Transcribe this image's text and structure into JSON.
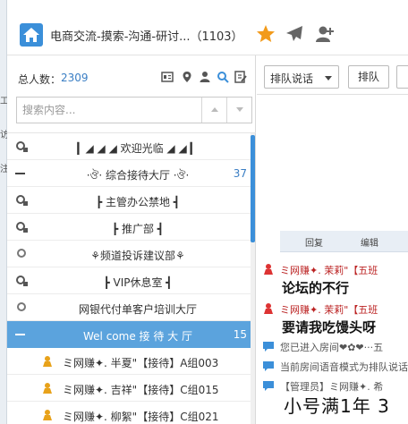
{
  "window": {
    "title": "电商交流-摸索-沟通-研讨...（1103）"
  },
  "background_window": {
    "fragments": [
      "工",
      "访",
      "注"
    ]
  },
  "stats": {
    "label": "总人数：",
    "count": "2309"
  },
  "search": {
    "placeholder": "搜索内容..."
  },
  "channels": [
    {
      "name": "▎◢ ◢ ◢  欢迎光临  ◢ ◢ ▎",
      "count": ""
    },
    {
      "name": "·ঔ· 综合接待大厅 ·ঔ·",
      "count": "37"
    },
    {
      "name": "┣    主管办公禁地    ┫",
      "count": ""
    },
    {
      "name": "┣   推广部   ┫",
      "count": ""
    },
    {
      "name": "⚘频道投诉建议部⚘",
      "count": ""
    },
    {
      "name": "┣   VIP休息室   ┫",
      "count": ""
    },
    {
      "name": "网银代付单客户培训大厅",
      "count": ""
    },
    {
      "name": "Wel come  接 待 大 厅",
      "count": "15"
    }
  ],
  "members": [
    {
      "name": "ミ网赚✦. 半夏\"【接待】A组003"
    },
    {
      "name": "ミ网赚✦. 吉祥\"【接待】C组015"
    },
    {
      "name": "ミ网赚✦. 柳絮\"【接待】C组021"
    }
  ],
  "right_controls": {
    "mode_dropdown": "排队说话",
    "queue_button": "排队"
  },
  "image_strip": {
    "reply": "回复",
    "edit": "编辑"
  },
  "chat_messages": [
    {
      "sender": "ミ网赚✦. 茉莉\"【五班",
      "text": "论坛的不行"
    },
    {
      "sender": "ミ网赚✦. 茉莉\"【五班",
      "text": "要请我吃馒头呀"
    },
    {
      "system": "您已进入房间❤✿❤···五"
    },
    {
      "system": "当前房间语音模式为排队说话"
    },
    {
      "system": "【管理员】ミ网赚✦. 希"
    }
  ],
  "big_text": "小号满1年  3",
  "colors": {
    "accent": "#3b8fd9",
    "selected_row": "#5ba3dd",
    "count_text": "#3a7ec4",
    "star": "#f29a1a"
  },
  "icons": {
    "app": "home-icon",
    "favorite": "star-icon",
    "share": "plane-icon",
    "add_user": "add-user-icon"
  }
}
